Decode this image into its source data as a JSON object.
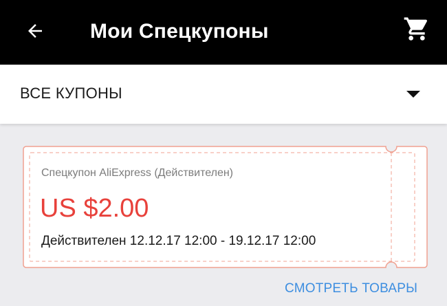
{
  "toolbar": {
    "title": "Мои Спецкупоны",
    "back_icon": "arrow-left-icon",
    "cart_icon": "shopping-cart-icon"
  },
  "filter": {
    "selected": "ВСЕ КУПОНЫ",
    "icon": "dropdown-arrow-icon"
  },
  "coupon": {
    "title": "Спецкупон AliExpress (Действителен)",
    "amount": "US $2.00",
    "validity": "Действителен 12.12.17 12:00 - 19.12.17 12:00"
  },
  "actions": {
    "view_products": "СМОТРЕТЬ ТОВАРЫ"
  },
  "colors": {
    "toolbar_bg": "#000000",
    "page_bg": "#ececef",
    "coupon_accent": "#e8413b",
    "coupon_border": "#f0a090",
    "link": "#3d8ee0"
  }
}
